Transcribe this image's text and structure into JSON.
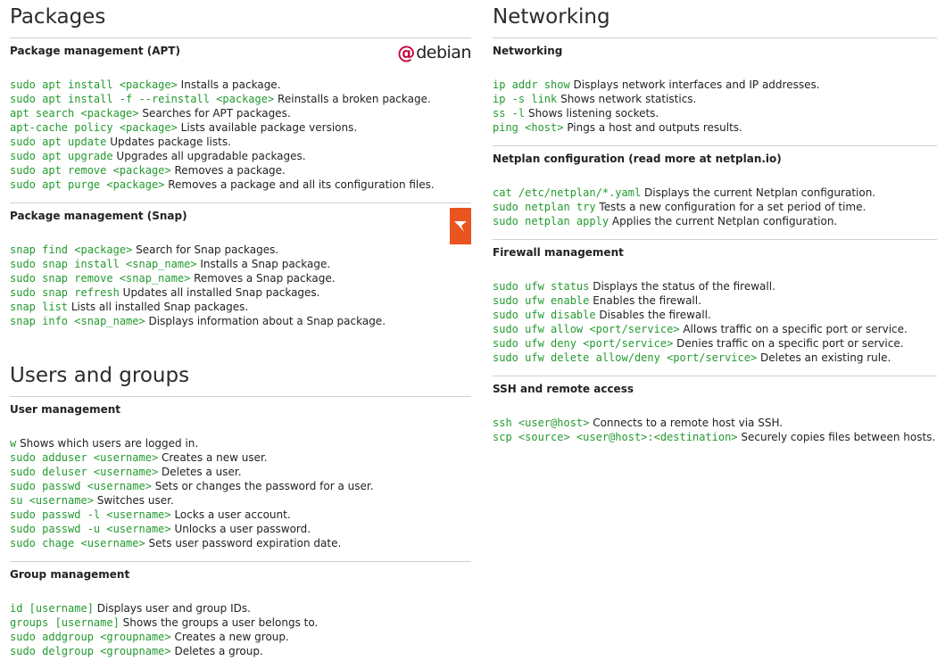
{
  "left": {
    "packages": {
      "title": "Packages",
      "apt": {
        "title": "Package management (APT)",
        "logo": "debian",
        "rows": [
          {
            "cmd": "sudo apt install <package>",
            "desc": "Installs a package."
          },
          {
            "cmd": "sudo apt install -f --reinstall <package>",
            "desc": "Reinstalls a broken package."
          },
          {
            "cmd": "apt search <package>",
            "desc": "Searches for APT packages."
          },
          {
            "cmd": "apt-cache policy <package>",
            "desc": "Lists available package versions."
          },
          {
            "cmd": "sudo apt update",
            "desc": "Updates package lists."
          },
          {
            "cmd": "sudo apt upgrade",
            "desc": "Upgrades all upgradable packages."
          },
          {
            "cmd": "sudo apt remove <package>",
            "desc": "Removes a package."
          },
          {
            "cmd": "sudo apt purge <package>",
            "desc": "Removes a package and all its configuration files."
          }
        ]
      },
      "snap": {
        "title": "Package management (Snap)",
        "rows": [
          {
            "cmd": "snap find <package>",
            "desc": "Search for Snap packages."
          },
          {
            "cmd": "sudo snap install <snap_name>",
            "desc": "Installs a Snap package."
          },
          {
            "cmd": "sudo snap remove <snap_name>",
            "desc": "Removes a Snap package."
          },
          {
            "cmd": "sudo snap refresh",
            "desc": "Updates all installed Snap packages."
          },
          {
            "cmd": "snap list",
            "desc": "Lists all installed Snap packages."
          },
          {
            "cmd": "snap info <snap_name>",
            "desc": "Displays information about a Snap package."
          }
        ]
      }
    },
    "users": {
      "title": "Users and groups",
      "user_mgmt": {
        "title": "User management",
        "rows": [
          {
            "cmd": "w",
            "desc": "Shows which users are logged in."
          },
          {
            "cmd": "sudo adduser <username>",
            "desc": "Creates a new user."
          },
          {
            "cmd": "sudo deluser <username>",
            "desc": "Deletes a user."
          },
          {
            "cmd": "sudo passwd <username>",
            "desc": "Sets or changes the password for a user."
          },
          {
            "cmd": "su <username>",
            "desc": "Switches user."
          },
          {
            "cmd": "sudo passwd -l <username>",
            "desc": "Locks a user account."
          },
          {
            "cmd": "sudo passwd -u <username>",
            "desc": "Unlocks a user password."
          },
          {
            "cmd": "sudo chage <username>",
            "desc": "Sets user password expiration date."
          }
        ]
      },
      "group_mgmt": {
        "title": "Group management",
        "rows": [
          {
            "cmd": "id [username]",
            "desc": "Displays user and group IDs."
          },
          {
            "cmd": "groups [username]",
            "desc": "Shows the groups a user belongs to."
          },
          {
            "cmd": "sudo addgroup <groupname>",
            "desc": "Creates a new group."
          },
          {
            "cmd": "sudo delgroup <groupname>",
            "desc": "Deletes a group."
          }
        ]
      }
    }
  },
  "right": {
    "title": "Networking",
    "networking": {
      "title": "Networking",
      "rows": [
        {
          "cmd": "ip addr show",
          "desc": "Displays network interfaces and IP addresses."
        },
        {
          "cmd": "ip -s link",
          "desc": "Shows network statistics."
        },
        {
          "cmd": "ss -l",
          "desc": "Shows listening sockets."
        },
        {
          "cmd": "ping <host>",
          "desc": "Pings a host and outputs results."
        }
      ]
    },
    "netplan": {
      "title": "Netplan configuration (read more at netplan.io)",
      "rows": [
        {
          "cmd": "cat /etc/netplan/*.yaml",
          "desc": "Displays the current Netplan configuration."
        },
        {
          "cmd": "sudo netplan try",
          "desc": "Tests a new configuration for a set period of time."
        },
        {
          "cmd": "sudo netplan apply",
          "desc": "Applies the current Netplan configuration."
        }
      ]
    },
    "firewall": {
      "title": "Firewall management",
      "rows": [
        {
          "cmd": "sudo ufw status",
          "desc": "Displays the status of the firewall."
        },
        {
          "cmd": "sudo ufw enable",
          "desc": "Enables the firewall."
        },
        {
          "cmd": "sudo ufw disable",
          "desc": "Disables the firewall."
        },
        {
          "cmd": "sudo ufw allow <port/service>",
          "desc": "Allows traffic on a specific port or service."
        },
        {
          "cmd": "sudo ufw deny <port/service>",
          "desc": "Denies traffic on a specific port or service."
        },
        {
          "cmd": "sudo ufw delete allow/deny <port/service>",
          "desc": "Deletes an existing rule."
        }
      ]
    },
    "ssh": {
      "title": "SSH and remote access",
      "rows": [
        {
          "cmd": "ssh <user@host>",
          "desc": "Connects to a remote host via SSH."
        },
        {
          "cmd": "scp <source> <user@host>:<destination>",
          "desc": "Securely copies files between hosts."
        }
      ]
    }
  },
  "colors": {
    "command": "#239a2f",
    "snap_brand": "#e95420",
    "debian_brand": "#c70036"
  }
}
